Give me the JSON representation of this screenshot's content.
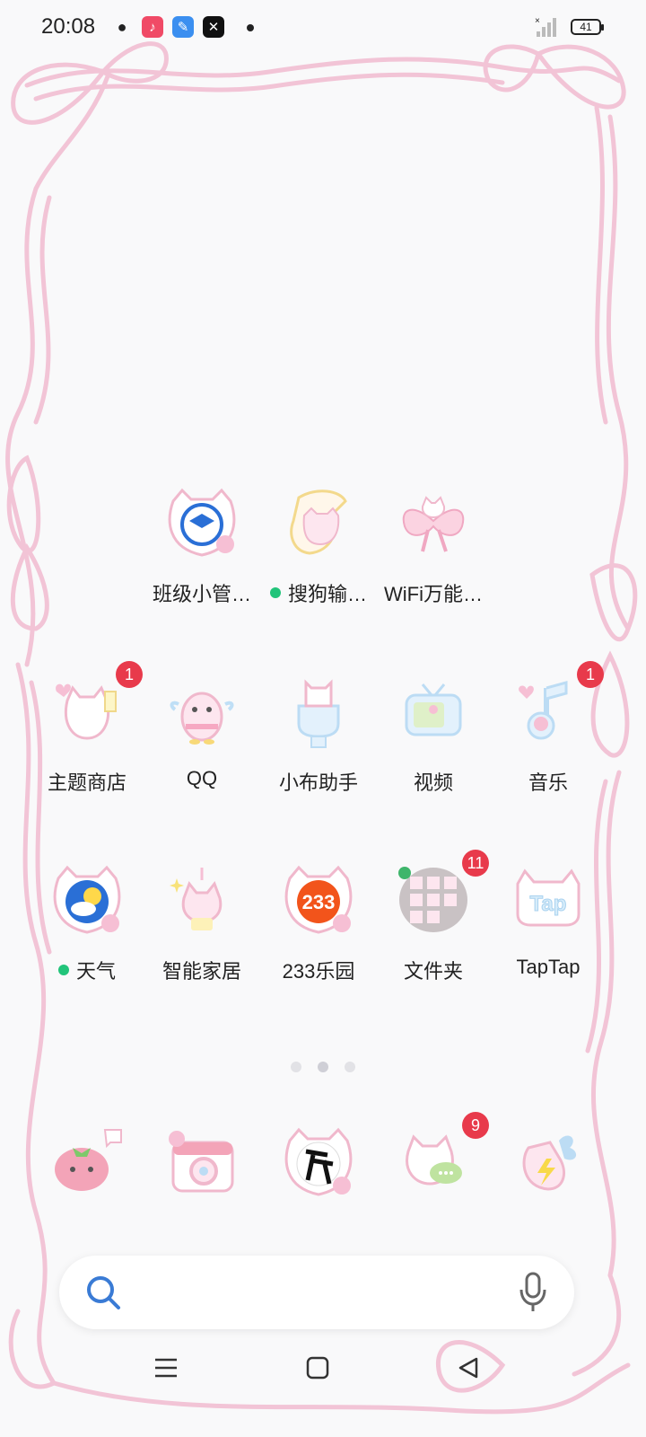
{
  "status_bar": {
    "time": "20:08",
    "battery": "41",
    "notification_icons": [
      "wechat-icon",
      "music-icon",
      "feather-icon",
      "capcut-icon"
    ]
  },
  "page_indicator": {
    "pages": 3,
    "active": 1
  },
  "apps_row1": [
    {
      "label": "班级小管…",
      "dot": false
    },
    {
      "label": "搜狗输…",
      "dot": true
    },
    {
      "label": "WiFi万能…",
      "dot": false
    }
  ],
  "apps_row2": [
    {
      "label": "主题商店",
      "badge": "1"
    },
    {
      "label": "QQ"
    },
    {
      "label": "小布助手"
    },
    {
      "label": "视频"
    },
    {
      "label": "音乐",
      "badge": "1"
    }
  ],
  "apps_row3": [
    {
      "label": "天气",
      "dot": true
    },
    {
      "label": "智能家居"
    },
    {
      "label": "233乐园",
      "icon_text": "233"
    },
    {
      "label": "文件夹",
      "badge": "11"
    },
    {
      "label": "TapTap",
      "icon_text": "Tap"
    }
  ],
  "dock": [
    {
      "name": "tomato-app-icon"
    },
    {
      "name": "camera-app-icon"
    },
    {
      "name": "game-app-icon"
    },
    {
      "name": "messages-app-icon",
      "badge": "9"
    },
    {
      "name": "bolt-app-icon"
    }
  ],
  "colors": {
    "ribbon": "#f2c4d6",
    "badge": "#e83a4b",
    "dot": "#22c47a",
    "accent": "#3a7bd5"
  }
}
